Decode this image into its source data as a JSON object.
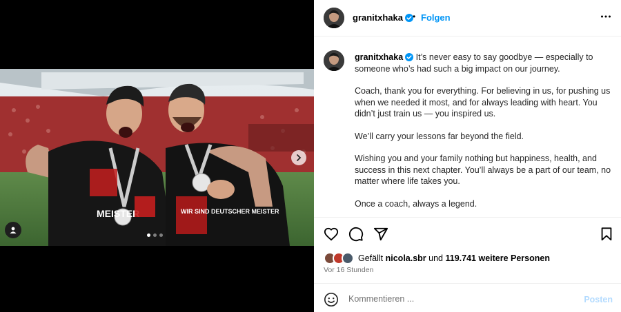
{
  "post": {
    "username": "granitxhaka",
    "follow_label": "Folgen",
    "separator": "•",
    "caption": {
      "paragraph_1": "It’s never easy to say goodbye — especially to someone who’s had such a big impact on our journey.",
      "paragraph_2": "Coach, thank you for everything. For believing in us, for pushing us when we needed it most, and for always leading with heart. You didn’t just train us — you inspired us.",
      "paragraph_3": "We’ll carry your lessons far beyond the field.",
      "paragraph_4": "Wishing you and your family nothing but happiness, health, and success in this next chapter. You’ll always be a part of our team, no matter where life takes you.",
      "paragraph_5": "Once a coach, always a legend."
    },
    "likes": {
      "prefix": "Gefällt",
      "user": "nicola.sbr",
      "conjunction": "und",
      "count": "119.741 weitere Personen"
    },
    "timestamp": "Vor 16 Stunden"
  },
  "media": {
    "carousel_total": 3,
    "carousel_active": 1,
    "jersey_text_top": "MEISTER",
    "jersey_text_patch": "WIR SIND DEUTSCHER MEISTER"
  },
  "comment": {
    "placeholder": "Kommentieren ...",
    "post_label": "Posten"
  },
  "icons": {
    "verified": "verified-badge-icon",
    "more": "more-options-icon",
    "like": "heart-icon",
    "comment": "comment-icon",
    "share": "share-icon",
    "save": "bookmark-icon",
    "emoji": "emoji-icon",
    "next": "chevron-right-icon",
    "user_tag": "user-tag-icon"
  },
  "colors": {
    "accent": "#0095f6",
    "verified": "#0095f6",
    "post_disabled": "#b3dbff",
    "secondary_text": "#737373"
  }
}
